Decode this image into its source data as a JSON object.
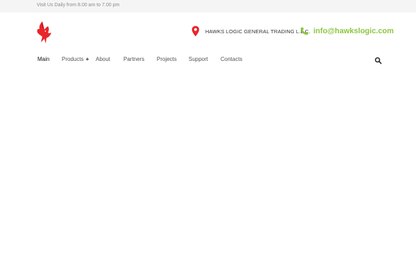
{
  "topbar": {
    "hours_text": "Visit Us Daily from 8.00 am to 7.00 pm"
  },
  "header": {
    "logo_icon": "hawk-logo-icon",
    "address_icon": "map-pin-icon",
    "company_name": "HAWKS LOGIC GENERAL TRADING L.L.C.",
    "phone_icon": "phone-icon",
    "email": "info@hawkslogic.com",
    "colors": {
      "brand_red": "#e8262b",
      "accent_green": "#8dc63f"
    }
  },
  "nav": {
    "items": [
      {
        "label": "Main"
      },
      {
        "label": "Products",
        "suffix": "+"
      },
      {
        "label": "About"
      },
      {
        "label": "Partners"
      },
      {
        "label": "Projects"
      },
      {
        "label": "Support"
      },
      {
        "label": "Contacts"
      }
    ],
    "search_icon": "search-icon"
  }
}
